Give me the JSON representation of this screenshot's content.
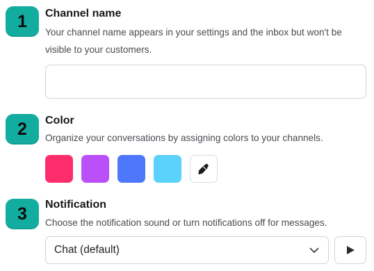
{
  "steps": [
    {
      "number": "1",
      "title": "Channel name",
      "description": "Your channel name appears in your settings and the inbox but won't be visible to your customers."
    },
    {
      "number": "2",
      "title": "Color",
      "description": "Organize your conversations by assigning colors to your channels."
    },
    {
      "number": "3",
      "title": "Notification",
      "description": "Choose the notification sound or turn notifications off for messages."
    }
  ],
  "channel_name_input": {
    "value": "",
    "placeholder": ""
  },
  "colors": {
    "swatches": [
      {
        "name": "pink",
        "hex": "#fd2d6c"
      },
      {
        "name": "purple",
        "hex": "#b950fa"
      },
      {
        "name": "blue",
        "hex": "#4f77fb"
      },
      {
        "name": "light-blue",
        "hex": "#5ad2fb"
      }
    ],
    "picker_icon": "eyedropper-icon",
    "step_badge_color": "#13ada0"
  },
  "notification": {
    "selected_sound": "Chat (default)",
    "dropdown_icon": "chevron-down-icon",
    "play_icon": "play-icon"
  }
}
